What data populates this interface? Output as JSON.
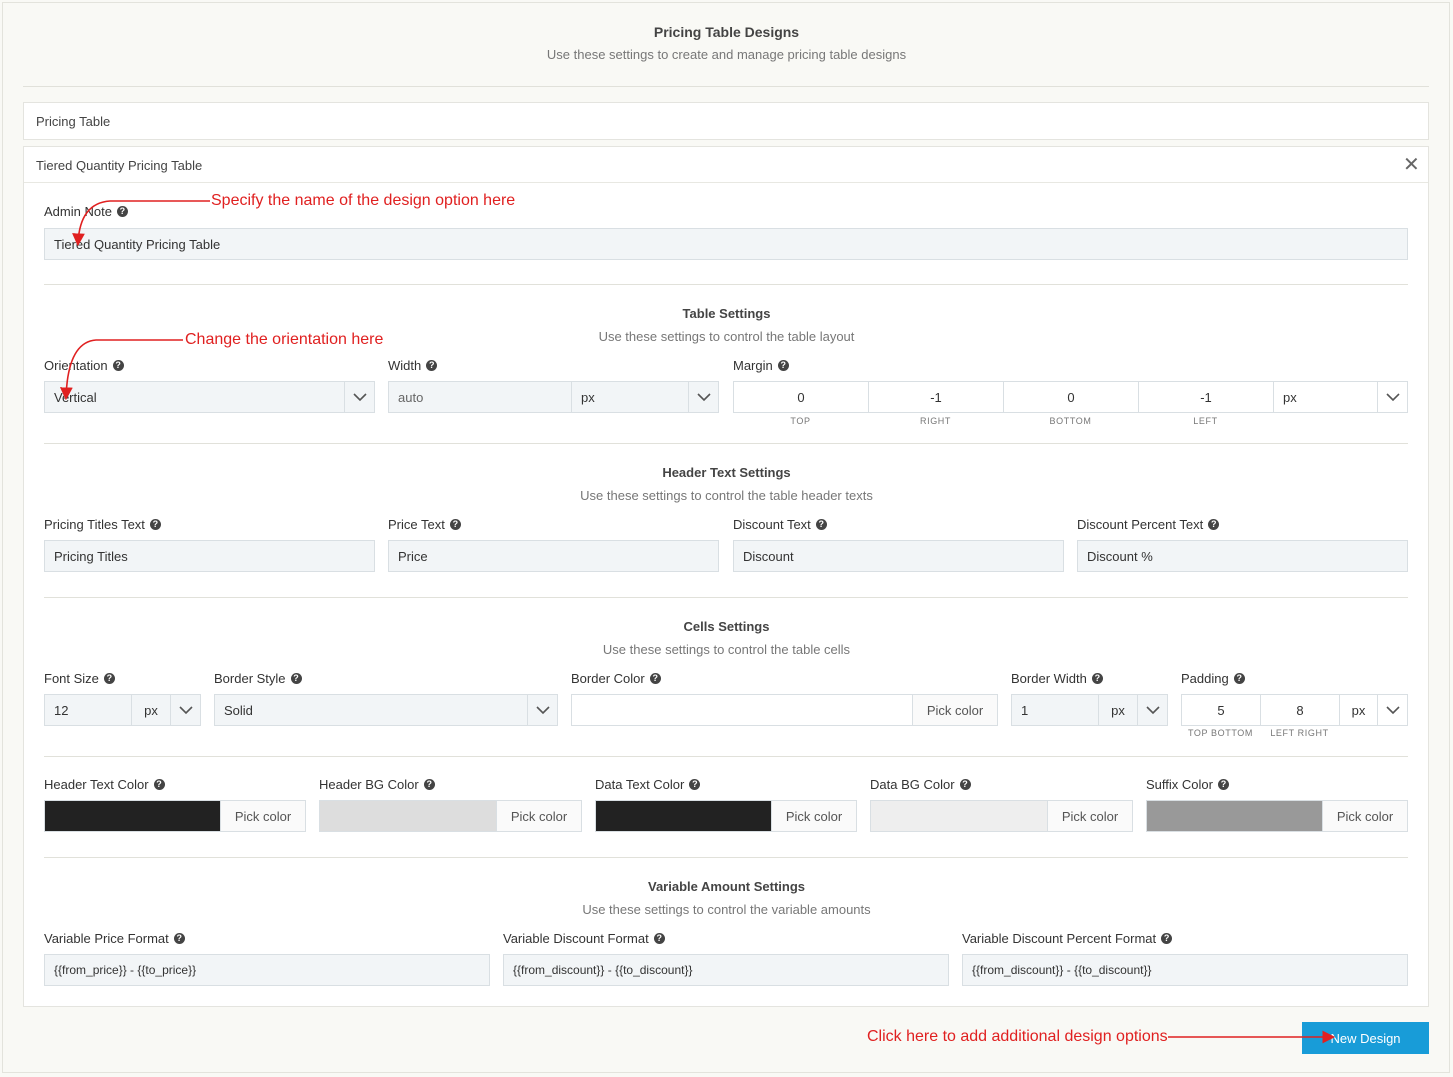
{
  "page": {
    "title": "Pricing Table Designs",
    "subtitle": "Use these settings to create and manage pricing table designs"
  },
  "panels": {
    "pricing_table": "Pricing Table",
    "tiered": "Tiered Quantity Pricing Table"
  },
  "admin_note": {
    "label": "Admin Note",
    "value": "Tiered Quantity Pricing Table"
  },
  "table_settings": {
    "title": "Table Settings",
    "subtitle": "Use these settings to control the table layout",
    "orientation": {
      "label": "Orientation",
      "value": "Vertical"
    },
    "width": {
      "label": "Width",
      "value": "auto",
      "unit": "px"
    },
    "margin": {
      "label": "Margin",
      "top": "0",
      "right": "-1",
      "bottom": "0",
      "left": "-1",
      "unit": "px",
      "top_cap": "TOP",
      "right_cap": "RIGHT",
      "bottom_cap": "BOTTOM",
      "left_cap": "LEFT"
    }
  },
  "header_text": {
    "title": "Header Text Settings",
    "subtitle": "Use these settings to control the table header texts",
    "pricing_titles": {
      "label": "Pricing Titles Text",
      "value": "Pricing Titles"
    },
    "price": {
      "label": "Price Text",
      "value": "Price"
    },
    "discount": {
      "label": "Discount Text",
      "value": "Discount"
    },
    "discount_percent": {
      "label": "Discount Percent Text",
      "value": "Discount %"
    }
  },
  "cells": {
    "title": "Cells Settings",
    "subtitle": "Use these settings to control the table cells",
    "font_size": {
      "label": "Font Size",
      "value": "12",
      "unit": "px"
    },
    "border_style": {
      "label": "Border Style",
      "value": "Solid"
    },
    "border_color": {
      "label": "Border Color",
      "pick": "Pick color"
    },
    "border_width": {
      "label": "Border Width",
      "value": "1",
      "unit": "px"
    },
    "padding": {
      "label": "Padding",
      "top_bottom": "5",
      "left_right": "8",
      "unit": "px",
      "tb_cap": "TOP BOTTOM",
      "lr_cap": "LEFT RIGHT"
    }
  },
  "colors": {
    "header_text": {
      "label": "Header Text Color",
      "pick": "Pick color",
      "color": "#222222"
    },
    "header_bg": {
      "label": "Header BG Color",
      "pick": "Pick color",
      "color": "#dddddd"
    },
    "data_text": {
      "label": "Data Text Color",
      "pick": "Pick color",
      "color": "#222222"
    },
    "data_bg": {
      "label": "Data BG Color",
      "pick": "Pick color",
      "color": "#eeeeee"
    },
    "suffix": {
      "label": "Suffix Color",
      "pick": "Pick color",
      "color": "#999999"
    }
  },
  "variable": {
    "title": "Variable Amount Settings",
    "subtitle": "Use these settings to control the variable amounts",
    "price_format": {
      "label": "Variable Price Format",
      "value": "{{from_price}} - {{to_price}}"
    },
    "discount_format": {
      "label": "Variable Discount Format",
      "value": "{{from_discount}} - {{to_discount}}"
    },
    "discount_percent_format": {
      "label": "Variable Discount Percent Format",
      "value": "{{from_discount}} - {{to_discount}}"
    }
  },
  "annotations": {
    "name_note": "Specify the name of the design option here",
    "orientation_note": "Change the orientation here",
    "add_note": "Click here to add additional design options"
  },
  "new_design_button": "New Design"
}
